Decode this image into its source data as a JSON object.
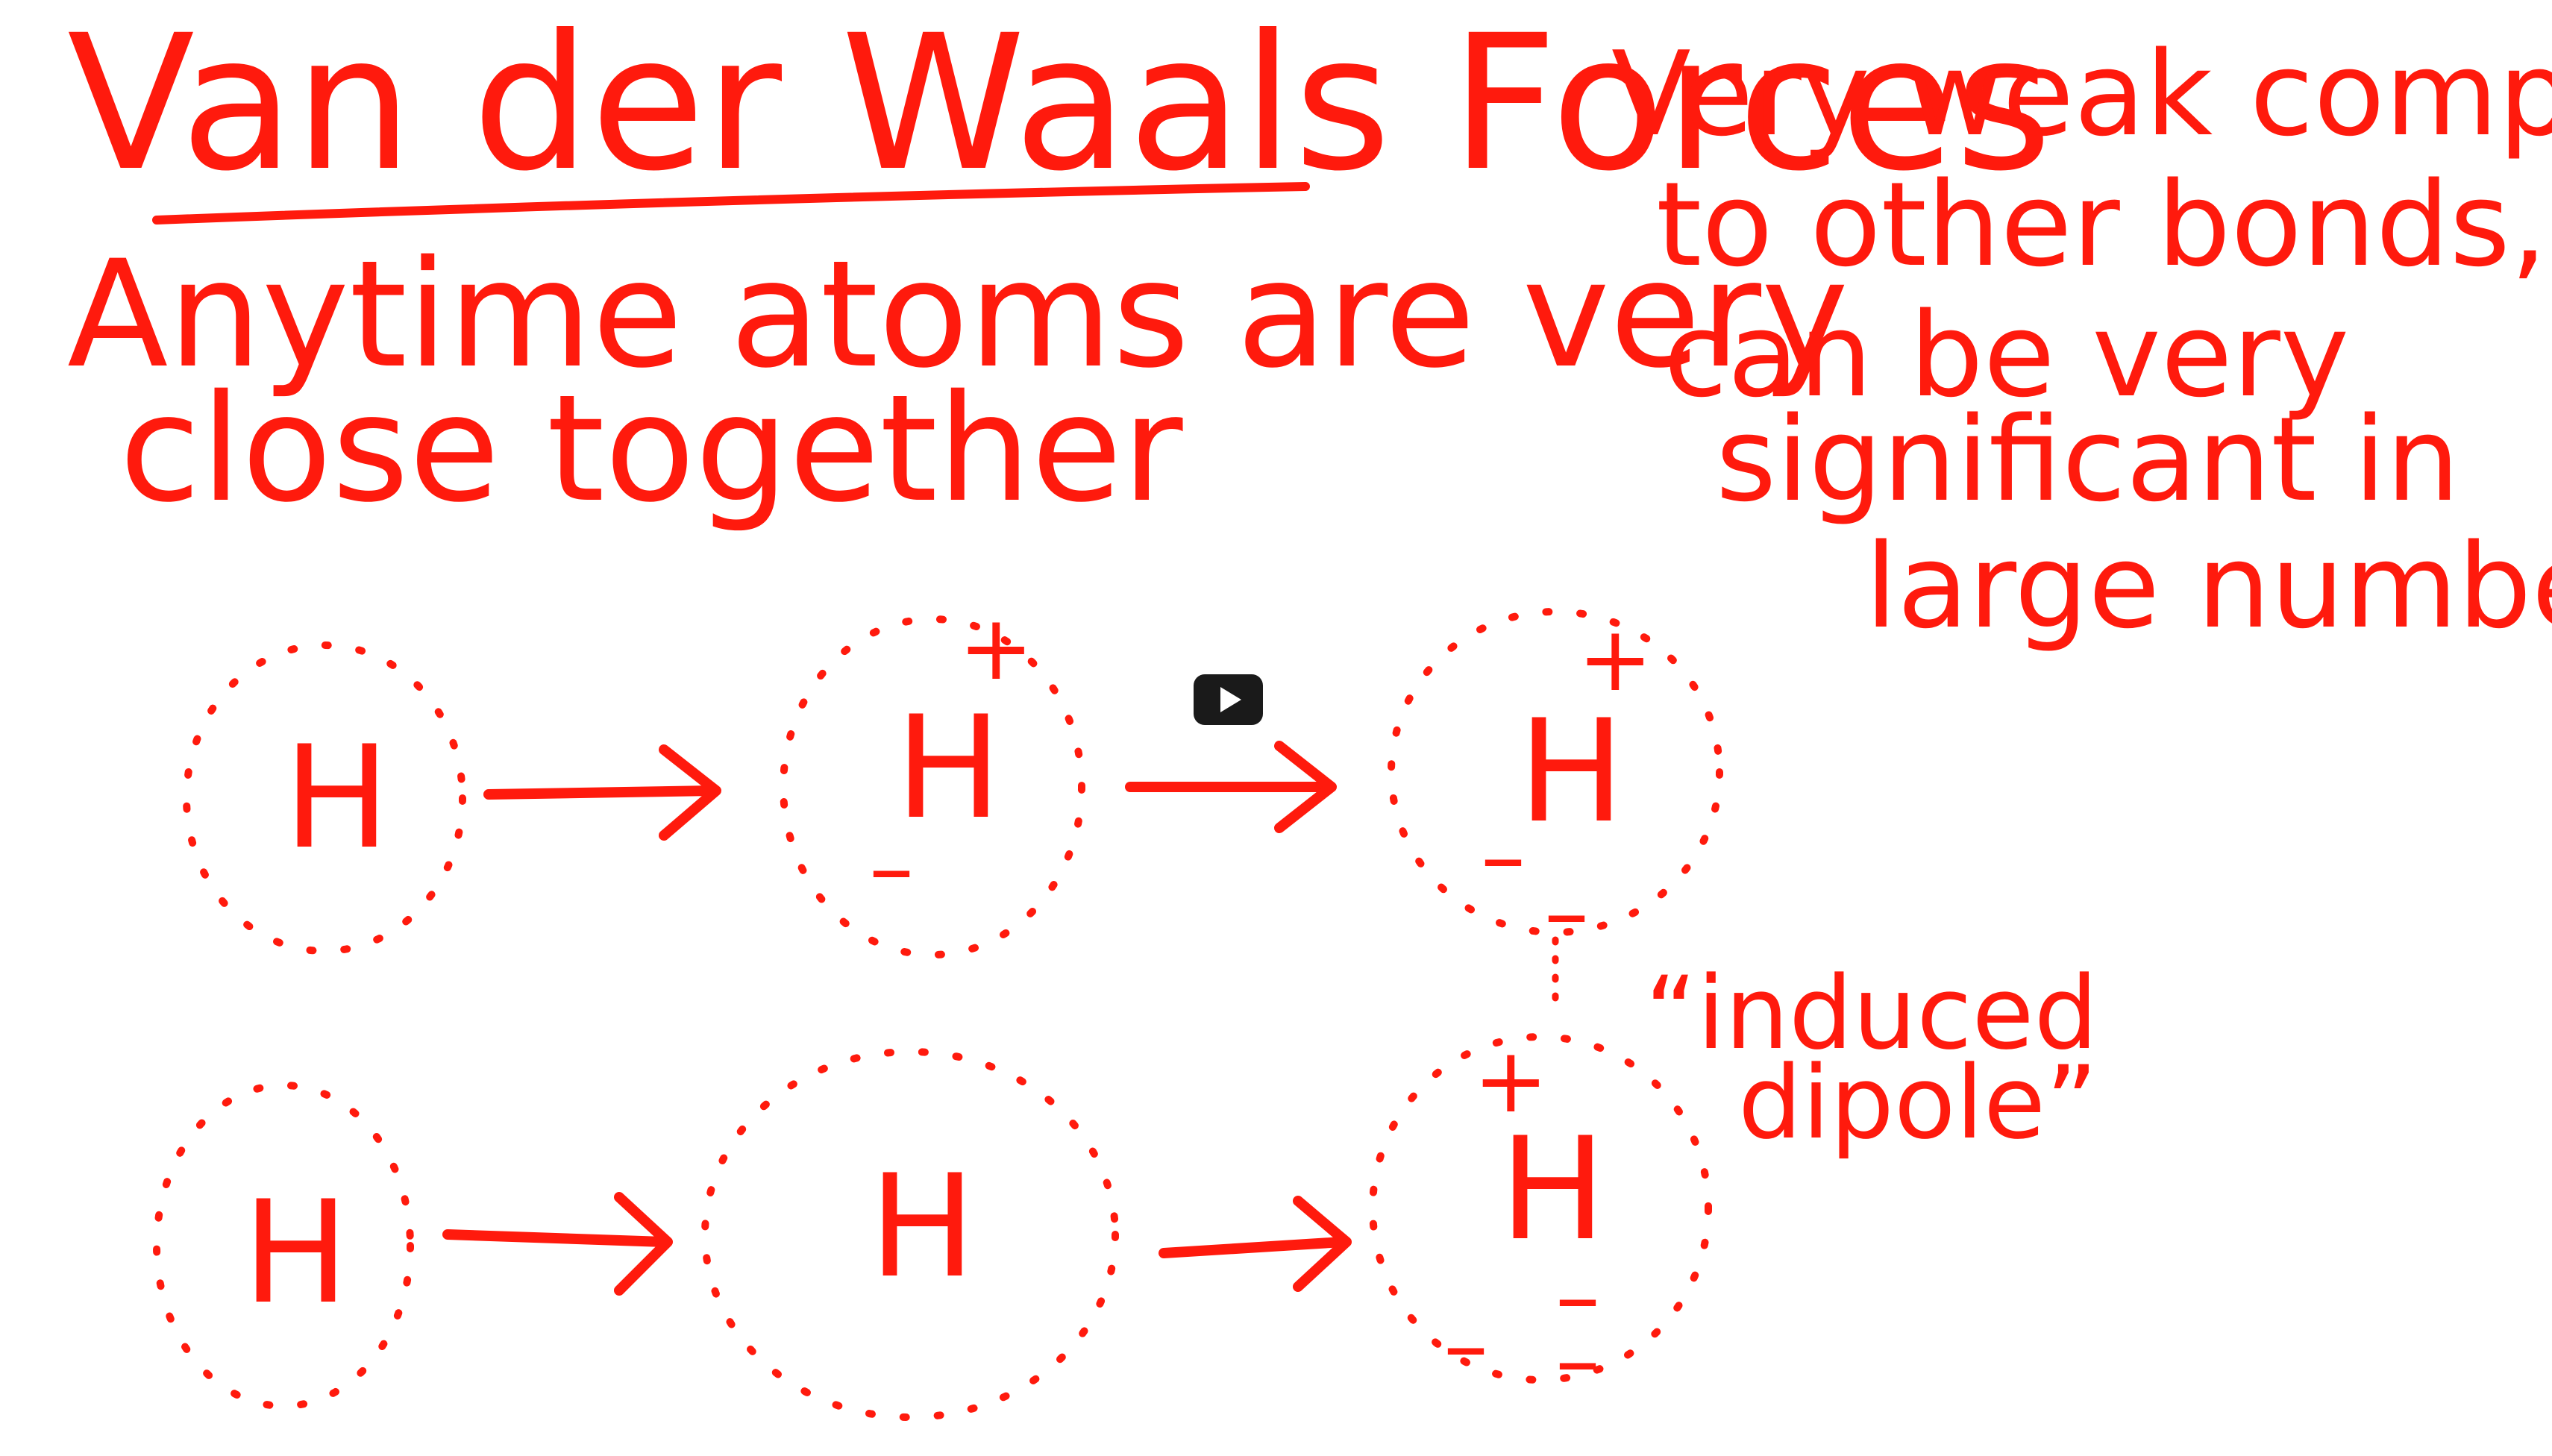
{
  "slide": {
    "title": "Van der Waals Forces",
    "definition": {
      "line1": "Anytime atoms are very",
      "line2": "close together"
    },
    "note": {
      "line1": "Very weak compared",
      "line2": "to other bonds, but",
      "line3": "can be very",
      "line4": "significant in",
      "line5": "large numbers"
    },
    "diagram": {
      "atom_label": "H",
      "plus": "+",
      "minus": "–",
      "induced_line1": "“induced",
      "induced_line2": "dipole”"
    },
    "ink_color": "#ff1a0d"
  },
  "player": {
    "play_icon": "play-icon",
    "button_color": "#1a1a1a"
  }
}
